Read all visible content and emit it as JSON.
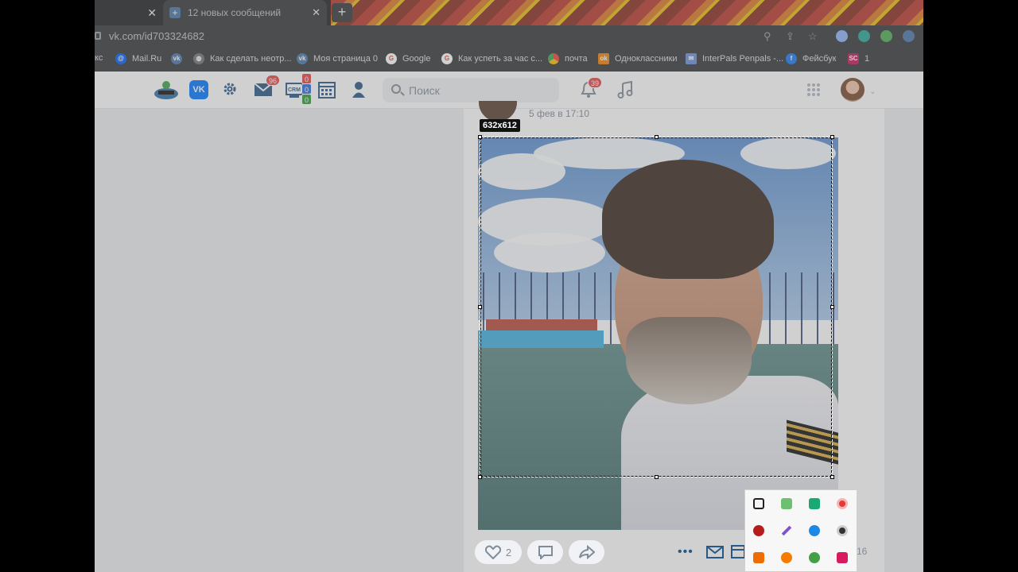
{
  "browser": {
    "tabs": [
      {
        "label": "",
        "close": "✕"
      },
      {
        "label": "12 новых сообщений",
        "close": "✕",
        "favicon": "+"
      }
    ],
    "new_tab": "+",
    "url": "vk.com/id703324682",
    "bookmarks": [
      {
        "label": "кс",
        "icon": "bookmark-icon"
      },
      {
        "label": "Mail.Ru",
        "icon": "mailru-icon",
        "color": "#005ff9"
      },
      {
        "label": "",
        "icon": "vk-icon",
        "color": "#4a76a8"
      },
      {
        "label": "Как сделать неотр...",
        "icon": "globe-icon",
        "color": "#9aa0a6"
      },
      {
        "label": "Моя страница 0",
        "icon": "vk-icon",
        "color": "#4a76a8"
      },
      {
        "label": "Google",
        "icon": "google-icon",
        "color": "#ea4335"
      },
      {
        "label": "Как успеть за час с...",
        "icon": "google-icon",
        "color": "#ea4335"
      },
      {
        "label": "почта",
        "icon": "chrome-icon",
        "color": "#fbbc05"
      },
      {
        "label": "Одноклассники",
        "icon": "ok-icon",
        "color": "#ee8208"
      },
      {
        "label": "InterPals Penpals -...",
        "icon": "interpals-icon",
        "color": "#6a8fd8"
      },
      {
        "label": "Фейсбук",
        "icon": "facebook-icon",
        "color": "#1877f2"
      },
      {
        "label": "1",
        "icon": "sc-icon",
        "color": "#c2185b"
      }
    ]
  },
  "header": {
    "vk_logo": "VK",
    "messages_badge": "96",
    "crm_label": "CRM",
    "crm_counts": [
      "0",
      "0",
      "0"
    ],
    "search_placeholder": "Поиск",
    "notifications_badge": "39"
  },
  "post": {
    "date": "5 фев в 17:10",
    "likes": "2",
    "views": "16"
  },
  "selection": {
    "dimensions": "632x612"
  },
  "colors": {
    "vk_blue": "#0077ff",
    "badge_red": "#e64646"
  }
}
